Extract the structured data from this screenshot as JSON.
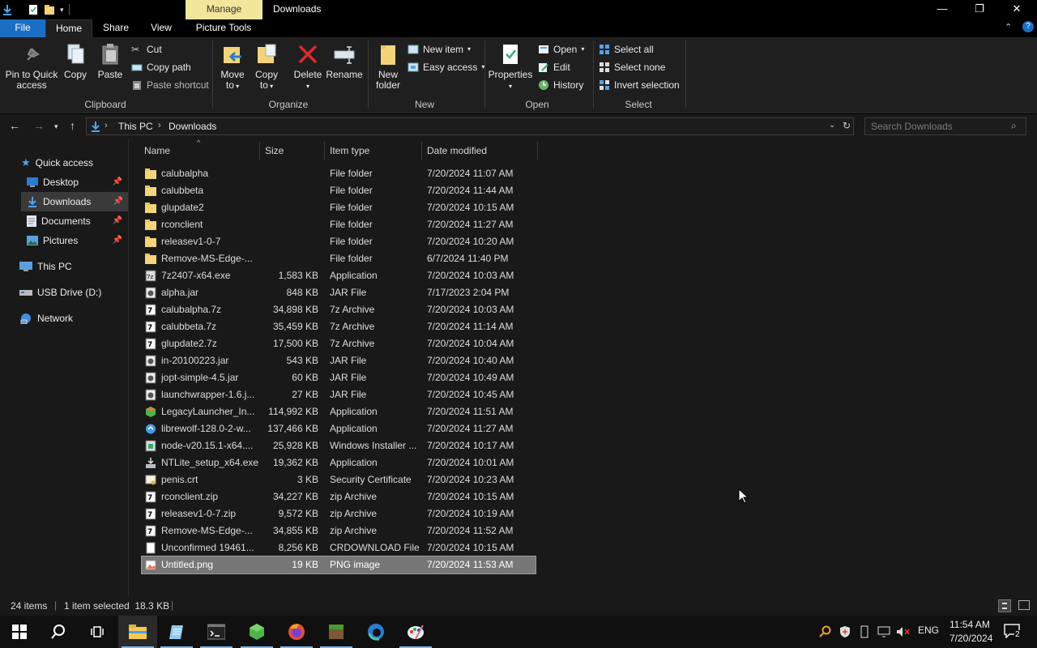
{
  "window": {
    "title": "Downloads",
    "manage_label": "Manage",
    "picture_tools_label": "Picture Tools",
    "minimize": "—",
    "restore": "❐",
    "close": "✕"
  },
  "tabs": [
    "File",
    "Home",
    "Share",
    "View"
  ],
  "ribbon": {
    "clipboard": {
      "label": "Clipboard",
      "pin_line1": "Pin to Quick",
      "pin_line2": "access",
      "copy": "Copy",
      "paste": "Paste",
      "cut": "Cut",
      "copy_path": "Copy path",
      "paste_shortcut": "Paste shortcut"
    },
    "organize": {
      "label": "Organize",
      "move_to_line1": "Move",
      "move_to_line2": "to",
      "copy_to_line1": "Copy",
      "copy_to_line2": "to",
      "delete": "Delete",
      "rename": "Rename"
    },
    "new": {
      "label": "New",
      "new_folder_line1": "New",
      "new_folder_line2": "folder",
      "new_item": "New item",
      "easy_access": "Easy access"
    },
    "open": {
      "label": "Open",
      "properties": "Properties",
      "open": "Open",
      "edit": "Edit",
      "history": "History"
    },
    "select": {
      "label": "Select",
      "select_all": "Select all",
      "select_none": "Select none",
      "invert_selection": "Invert selection"
    }
  },
  "address": {
    "this_pc": "This PC",
    "downloads": "Downloads",
    "separator": "›"
  },
  "search": {
    "placeholder": "Search Downloads"
  },
  "nav_pane": {
    "quick_access": "Quick access",
    "desktop": "Desktop",
    "downloads": "Downloads",
    "documents": "Documents",
    "pictures": "Pictures",
    "this_pc": "This PC",
    "usb_drive": "USB Drive (D:)",
    "network": "Network"
  },
  "columns": {
    "name": "Name",
    "size": "Size",
    "item_type": "Item type",
    "date_modified": "Date modified"
  },
  "files": [
    {
      "name": "calubalpha",
      "size": "",
      "type": "File folder",
      "date": "7/20/2024 11:07 AM",
      "icon": "folder"
    },
    {
      "name": "calubbeta",
      "size": "",
      "type": "File folder",
      "date": "7/20/2024 11:44 AM",
      "icon": "folder"
    },
    {
      "name": "glupdate2",
      "size": "",
      "type": "File folder",
      "date": "7/20/2024 10:15 AM",
      "icon": "folder"
    },
    {
      "name": "rconclient",
      "size": "",
      "type": "File folder",
      "date": "7/20/2024 11:27 AM",
      "icon": "folder"
    },
    {
      "name": "releasev1-0-7",
      "size": "",
      "type": "File folder",
      "date": "7/20/2024 10:20 AM",
      "icon": "folder"
    },
    {
      "name": "Remove-MS-Edge-...",
      "size": "",
      "type": "File folder",
      "date": "6/7/2024 11:40 PM",
      "icon": "folder"
    },
    {
      "name": "7z2407-x64.exe",
      "size": "1,583 KB",
      "type": "Application",
      "date": "7/20/2024 10:03 AM",
      "icon": "7z-exe"
    },
    {
      "name": "alpha.jar",
      "size": "848 KB",
      "type": "JAR File",
      "date": "7/17/2023 2:04 PM",
      "icon": "jar"
    },
    {
      "name": "calubalpha.7z",
      "size": "34,898 KB",
      "type": "7z Archive",
      "date": "7/20/2024 10:03 AM",
      "icon": "7z"
    },
    {
      "name": "calubbeta.7z",
      "size": "35,459 KB",
      "type": "7z Archive",
      "date": "7/20/2024 11:14 AM",
      "icon": "7z"
    },
    {
      "name": "glupdate2.7z",
      "size": "17,500 KB",
      "type": "7z Archive",
      "date": "7/20/2024 10:04 AM",
      "icon": "7z"
    },
    {
      "name": "in-20100223.jar",
      "size": "543 KB",
      "type": "JAR File",
      "date": "7/20/2024 10:40 AM",
      "icon": "jar"
    },
    {
      "name": "jopt-simple-4.5.jar",
      "size": "60 KB",
      "type": "JAR File",
      "date": "7/20/2024 10:49 AM",
      "icon": "jar"
    },
    {
      "name": "launchwrapper-1.6.j...",
      "size": "27 KB",
      "type": "JAR File",
      "date": "7/20/2024 10:45 AM",
      "icon": "jar"
    },
    {
      "name": "LegacyLauncher_In...",
      "size": "114,992 KB",
      "type": "Application",
      "date": "7/20/2024 11:51 AM",
      "icon": "app-green"
    },
    {
      "name": "librewolf-128.0-2-w...",
      "size": "137,466 KB",
      "type": "Application",
      "date": "7/20/2024 11:27 AM",
      "icon": "app-blue"
    },
    {
      "name": "node-v20.15.1-x64....",
      "size": "25,928 KB",
      "type": "Windows Installer ...",
      "date": "7/20/2024 10:17 AM",
      "icon": "msi"
    },
    {
      "name": "NTLite_setup_x64.exe",
      "size": "19,362 KB",
      "type": "Application",
      "date": "7/20/2024 10:01 AM",
      "icon": "setup"
    },
    {
      "name": "penis.crt",
      "size": "3 KB",
      "type": "Security Certificate",
      "date": "7/20/2024 10:23 AM",
      "icon": "cert"
    },
    {
      "name": "rconclient.zip",
      "size": "34,227 KB",
      "type": "zip Archive",
      "date": "7/20/2024 10:15 AM",
      "icon": "7z"
    },
    {
      "name": "releasev1-0-7.zip",
      "size": "9,572 KB",
      "type": "zip Archive",
      "date": "7/20/2024 10:19 AM",
      "icon": "7z"
    },
    {
      "name": "Remove-MS-Edge-...",
      "size": "34,855 KB",
      "type": "zip Archive",
      "date": "7/20/2024 11:52 AM",
      "icon": "7z"
    },
    {
      "name": "Unconfirmed 19461...",
      "size": "8,256 KB",
      "type": "CRDOWNLOAD File",
      "date": "7/20/2024 10:15 AM",
      "icon": "blank"
    },
    {
      "name": "Untitled.png",
      "size": "19 KB",
      "type": "PNG image",
      "date": "7/20/2024 11:53 AM",
      "icon": "png",
      "selected": true
    }
  ],
  "status": {
    "item_count": "24 items",
    "selection": "1 item selected  18.3 KB"
  },
  "taskbar": {
    "apps": [
      "start-icon",
      "search-icon",
      "task-view-icon",
      "file-explorer-icon",
      "notepad-icon",
      "terminal-icon",
      "minecraft-launcher-icon",
      "firefox-icon",
      "minecraft-icon",
      "edge-icon",
      "paint-icon"
    ],
    "language": "ENG",
    "time": "11:54 AM",
    "date": "7/20/2024",
    "notifications": "2"
  },
  "colors": {
    "accent": "#1a6fc4",
    "folder": "#e8c65a",
    "manage_tab": "#f2e69c",
    "selected_row": "#777777"
  }
}
